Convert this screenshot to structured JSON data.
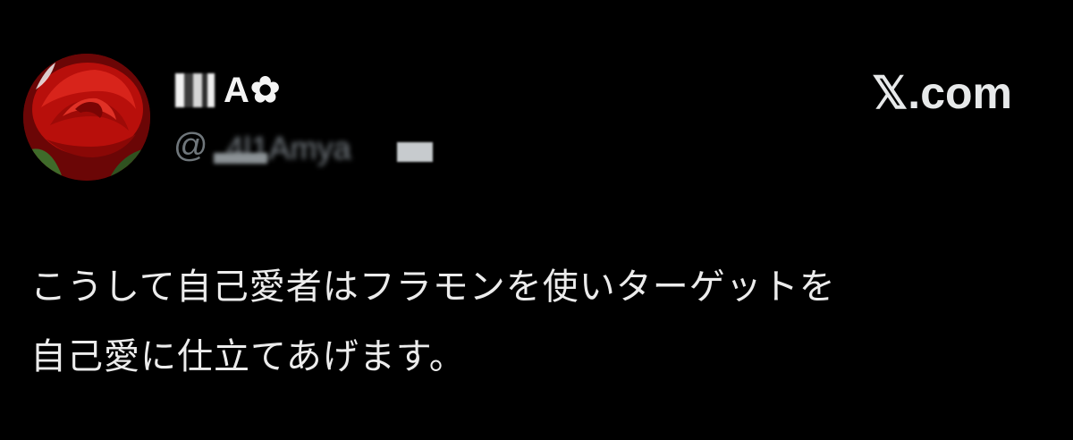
{
  "author": {
    "display_name": "A✿",
    "handle_prefix": "@",
    "handle_visible_fragment": "4l1Amya",
    "avatar_icon": "red-rose-photo"
  },
  "brand": {
    "label": "𝕏.com"
  },
  "tweet": {
    "lines": [
      "こうして自己愛者はフラモンを使いターゲットを",
      "自己愛に仕立てあげます。"
    ]
  },
  "colors": {
    "background": "#000000",
    "text_primary": "#e7e9ea",
    "text_secondary": "#6f767b",
    "avatar_rose": "#c0130f"
  }
}
